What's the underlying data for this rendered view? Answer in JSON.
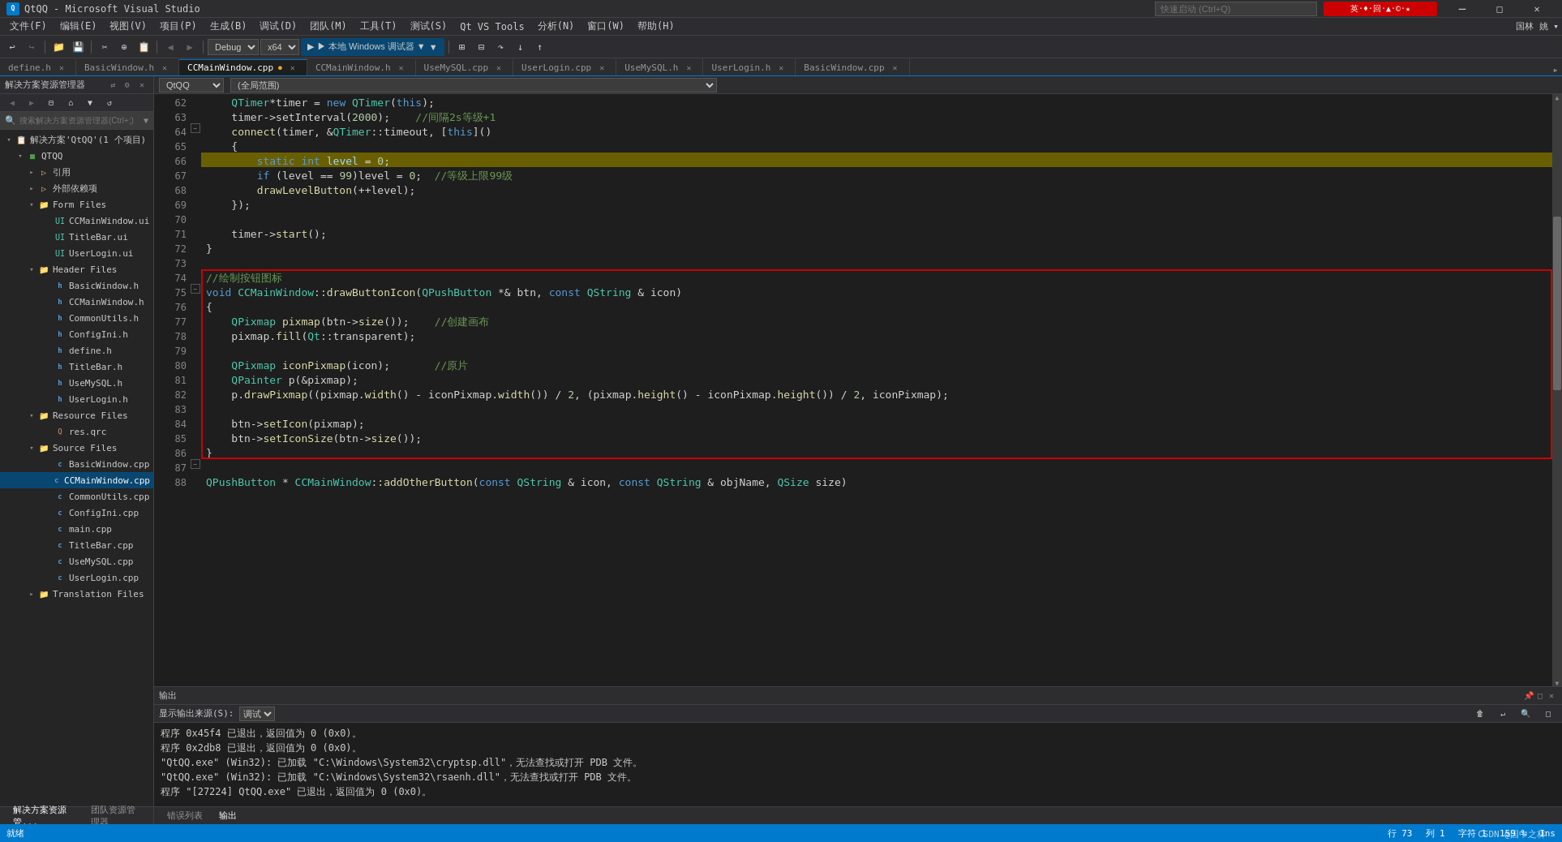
{
  "app": {
    "title": "QtQQ - Microsoft Visual Studio",
    "icon": "VS"
  },
  "title_bar": {
    "title": "QtQQ - Microsoft Visual Studio",
    "minimize": "─",
    "restore": "□",
    "close": "✕",
    "search_placeholder": "快速启动 (Ctrl+Q)"
  },
  "menu": {
    "items": [
      "文件(F)",
      "编辑(E)",
      "视图(V)",
      "项目(P)",
      "生成(B)",
      "调试(D)",
      "团队(M)",
      "工具(T)",
      "测试(S)",
      "Qt VS Tools",
      "分析(N)",
      "窗口(W)",
      "帮助(H)"
    ]
  },
  "toolbar": {
    "config": "Debug",
    "platform": "x64",
    "run_label": "▶ 本地 Windows 调试器 ▼"
  },
  "solution_explorer": {
    "header": "解决方案资源管理器",
    "search_placeholder": "搜索解决方案资源管理器(Ctrl+;)",
    "tree": [
      {
        "label": "解决方案'QtQQ'(1 个项目)",
        "level": 0,
        "expanded": true,
        "icon": "solution"
      },
      {
        "label": "QTQQ",
        "level": 1,
        "expanded": true,
        "icon": "project"
      },
      {
        "label": "引用",
        "level": 2,
        "expanded": false,
        "icon": "folder"
      },
      {
        "label": "外部依赖项",
        "level": 2,
        "expanded": false,
        "icon": "folder"
      },
      {
        "label": "Form Files",
        "level": 2,
        "expanded": true,
        "icon": "folder"
      },
      {
        "label": "CCMainWindow.ui",
        "level": 3,
        "icon": "ui"
      },
      {
        "label": "TitleBar.ui",
        "level": 3,
        "icon": "ui"
      },
      {
        "label": "UserLogin.ui",
        "level": 3,
        "icon": "ui"
      },
      {
        "label": "Header Files",
        "level": 2,
        "expanded": true,
        "icon": "folder"
      },
      {
        "label": "BasicWindow.h",
        "level": 3,
        "icon": "h"
      },
      {
        "label": "CCMainWindow.h",
        "level": 3,
        "icon": "h"
      },
      {
        "label": "CommonUtils.h",
        "level": 3,
        "icon": "h"
      },
      {
        "label": "ConfigIni.h",
        "level": 3,
        "icon": "h"
      },
      {
        "label": "define.h",
        "level": 3,
        "icon": "h"
      },
      {
        "label": "TitleBar.h",
        "level": 3,
        "icon": "h"
      },
      {
        "label": "UseMySQL.h",
        "level": 3,
        "icon": "h"
      },
      {
        "label": "UserLogin.h",
        "level": 3,
        "icon": "h"
      },
      {
        "label": "Resource Files",
        "level": 2,
        "expanded": true,
        "icon": "folder"
      },
      {
        "label": "res.qrc",
        "level": 3,
        "icon": "qrc"
      },
      {
        "label": "Source Files",
        "level": 2,
        "expanded": true,
        "icon": "folder"
      },
      {
        "label": "BasicWindow.cpp",
        "level": 3,
        "icon": "cpp"
      },
      {
        "label": "CCMainWindow.cpp",
        "level": 3,
        "icon": "cpp",
        "selected": true
      },
      {
        "label": "CommonUtils.cpp",
        "level": 3,
        "icon": "cpp"
      },
      {
        "label": "ConfigIni.cpp",
        "level": 3,
        "icon": "cpp"
      },
      {
        "label": "main.cpp",
        "level": 3,
        "icon": "cpp"
      },
      {
        "label": "TitleBar.cpp",
        "level": 3,
        "icon": "cpp"
      },
      {
        "label": "UseMySQL.cpp",
        "level": 3,
        "icon": "cpp"
      },
      {
        "label": "UserLogin.cpp",
        "level": 3,
        "icon": "cpp"
      },
      {
        "label": "Translation Files",
        "level": 2,
        "icon": "folder"
      }
    ]
  },
  "tabs": [
    {
      "label": "define.h",
      "active": false,
      "modified": false
    },
    {
      "label": "BasicWindow.h",
      "active": false,
      "modified": false
    },
    {
      "label": "CCMainWindow.cpp",
      "active": true,
      "modified": true
    },
    {
      "label": "CCMainWindow.h",
      "active": false,
      "modified": false
    },
    {
      "label": "UseMySQL.cpp",
      "active": false,
      "modified": false
    },
    {
      "label": "UserLogin.cpp",
      "active": false,
      "modified": false
    },
    {
      "label": "UseMySQL.h",
      "active": false,
      "modified": false
    },
    {
      "label": "UserLogin.h",
      "active": false,
      "modified": false
    },
    {
      "label": "BasicWindow.cpp",
      "active": false,
      "modified": false
    }
  ],
  "editor": {
    "scope1": "QtQQ",
    "scope2": "(全局范围)",
    "zoom": "159 %",
    "lines": [
      {
        "num": 62,
        "content": "    QTimer*timer = new QTimer(this);",
        "highlight": false
      },
      {
        "num": 63,
        "content": "    timer->setInterval(2000);    //间隔2s等级+1",
        "highlight": false
      },
      {
        "num": 64,
        "content": "    connect(timer, &QTimer::timeout, [this]()",
        "highlight": false
      },
      {
        "num": 65,
        "content": "    {",
        "highlight": false
      },
      {
        "num": 66,
        "content": "        static int level = 0;",
        "highlight": false
      },
      {
        "num": 67,
        "content": "        if (level == 99)level = 0;  //等级上限99级",
        "highlight": false
      },
      {
        "num": 68,
        "content": "        drawLevelButton(++level);",
        "highlight": false
      },
      {
        "num": 69,
        "content": "    });",
        "highlight": false
      },
      {
        "num": 70,
        "content": "",
        "highlight": false
      },
      {
        "num": 71,
        "content": "    timer->start();",
        "highlight": false
      },
      {
        "num": 72,
        "content": "}",
        "highlight": false
      },
      {
        "num": 73,
        "content": "",
        "highlight": false
      },
      {
        "num": 74,
        "content": "//绘制按钮图标",
        "highlight": false,
        "block_start": true
      },
      {
        "num": 75,
        "content": "void CCMainWindow::drawButtonIcon(QPushButton *& btn, const QString & icon)",
        "highlight": false
      },
      {
        "num": 76,
        "content": "{",
        "highlight": false
      },
      {
        "num": 77,
        "content": "    QPixmap pixmap(btn->size());    //创建画布",
        "highlight": false
      },
      {
        "num": 78,
        "content": "    pixmap.fill(Qt::transparent);",
        "highlight": false
      },
      {
        "num": 79,
        "content": "",
        "highlight": false
      },
      {
        "num": 80,
        "content": "    QPixmap iconPixmap(icon);       //原片",
        "highlight": false
      },
      {
        "num": 81,
        "content": "    QPainter p(&pixmap);",
        "highlight": false
      },
      {
        "num": 82,
        "content": "    p.drawPixmap((pixmap.width() - iconPixmap.width()) / 2, (pixmap.height() - iconPixmap.height()) / 2, iconPixmap);",
        "highlight": false
      },
      {
        "num": 83,
        "content": "",
        "highlight": false
      },
      {
        "num": 84,
        "content": "    btn->setIcon(pixmap);",
        "highlight": false
      },
      {
        "num": 85,
        "content": "    btn->setIconSize(btn->size());",
        "highlight": false,
        "block_end": true
      },
      {
        "num": 86,
        "content": "}",
        "highlight": false
      },
      {
        "num": 87,
        "content": "",
        "highlight": false
      },
      {
        "num": 88,
        "content": "QPushButton * CCMainWindow::addOtherButton(const QString & icon, const QString & objName, QSize size)",
        "highlight": false
      }
    ]
  },
  "output": {
    "tabs": [
      "输出",
      "错误列表"
    ],
    "active_tab": "输出",
    "source_label": "显示输出来源(S):",
    "source_value": "调试",
    "lines": [
      "程序 0x45f4 已退出，返回值为 0 (0x0)。",
      "程序 0x2db8 已退出，返回值为 0 (0x0)。",
      "\"QtQQ.exe\" (Win32): 已加载 \"C:\\Windows\\System32\\cryptsp.dll\"，无法查找或打开 PDB 文件。",
      "\"QtQQ.exe\" (Win32): 已加载 \"C:\\Windows\\System32\\rsaenh.dll\"，无法查找或打开 PDB 文件。",
      "程序 \"[27224] QtQQ.exe\" 已退出，返回值为 0 (0x0)。"
    ]
  },
  "status_bar": {
    "ready": "就绪",
    "line": "行 73",
    "col": "列 1",
    "char": "字符 1",
    "mode": "Ins",
    "watermark": "CSDN @国中之林"
  },
  "bottom_tabs": [
    "解决方案资源管...",
    "团队资源管理器"
  ]
}
